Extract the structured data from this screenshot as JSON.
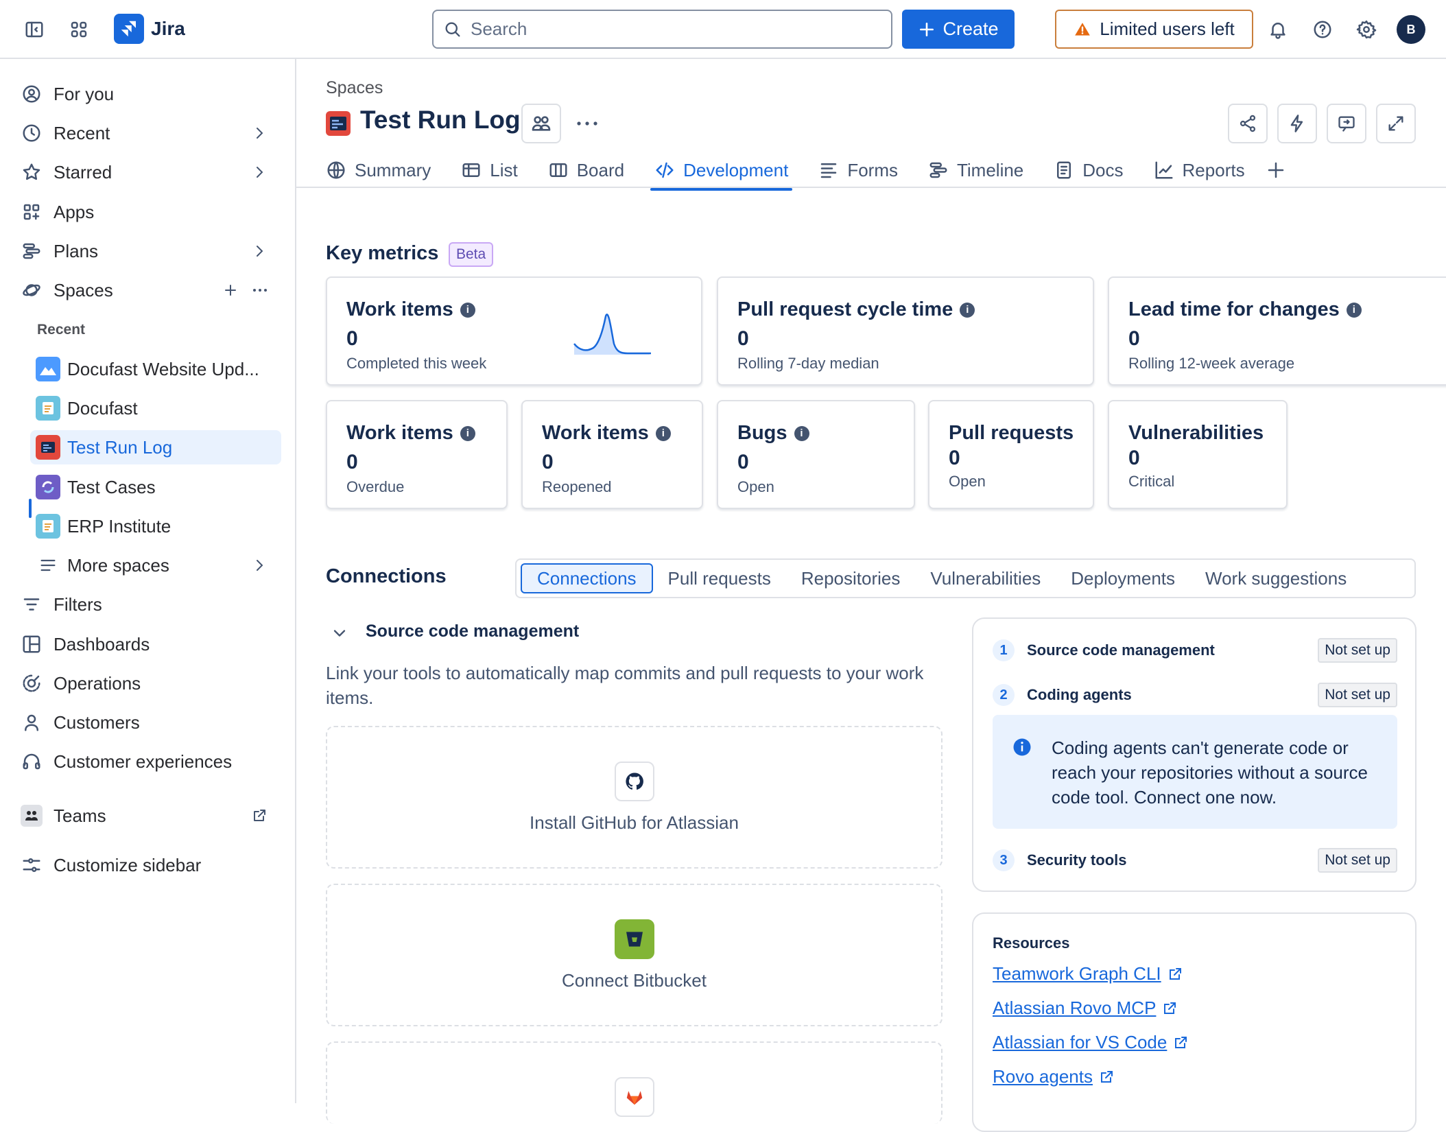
{
  "topbar": {
    "app_name": "Jira",
    "search_placeholder": "Search",
    "create_label": "Create",
    "limited_label": "Limited users left",
    "avatar_initial": "B"
  },
  "sidebar": {
    "items": [
      {
        "label": "For you",
        "icon": "user-circle-icon"
      },
      {
        "label": "Recent",
        "icon": "clock-icon"
      },
      {
        "label": "Starred",
        "icon": "star-icon"
      },
      {
        "label": "Apps",
        "icon": "apps-icon"
      },
      {
        "label": "Plans",
        "icon": "plans-icon"
      },
      {
        "label": "Spaces",
        "icon": "spaces-icon"
      }
    ],
    "recent_label": "Recent",
    "spaces": [
      {
        "label": "Docufast Website Upd...",
        "color": "#4c9aff"
      },
      {
        "label": "Docufast",
        "color": "#6cc3e0"
      },
      {
        "label": "Test Run Log",
        "color": "#e2483d"
      },
      {
        "label": "Test Cases",
        "color": "#6e5dc6"
      },
      {
        "label": "ERP Institute",
        "color": "#6cc3e0"
      }
    ],
    "more_spaces": "More spaces",
    "items2": [
      {
        "label": "Filters",
        "icon": "filter-icon"
      },
      {
        "label": "Dashboards",
        "icon": "dashboard-icon"
      },
      {
        "label": "Operations",
        "icon": "operations-icon"
      },
      {
        "label": "Customers",
        "icon": "person-icon"
      },
      {
        "label": "Customer experiences",
        "icon": "headphones-icon"
      }
    ],
    "teams": "Teams",
    "customize": "Customize sidebar"
  },
  "header": {
    "breadcrumb": "Spaces",
    "title": "Test Run Log",
    "tabs": [
      {
        "label": "Summary"
      },
      {
        "label": "List"
      },
      {
        "label": "Board"
      },
      {
        "label": "Development"
      },
      {
        "label": "Forms"
      },
      {
        "label": "Timeline"
      },
      {
        "label": "Docs"
      },
      {
        "label": "Reports"
      }
    ]
  },
  "metrics": {
    "title": "Key metrics",
    "beta": "Beta",
    "cards": [
      {
        "title": "Work items",
        "value": "0",
        "sub": "Completed this week"
      },
      {
        "title": "Pull request cycle time",
        "value": "0",
        "sub": "Rolling 7-day median"
      },
      {
        "title": "Lead time for changes",
        "value": "0",
        "sub": "Rolling 12-week average"
      },
      {
        "title": "Work items",
        "value": "0",
        "sub": "Overdue"
      },
      {
        "title": "Work items",
        "value": "0",
        "sub": "Reopened"
      },
      {
        "title": "Bugs",
        "value": "0",
        "sub": "Open"
      },
      {
        "title": "Pull requests",
        "value": "0",
        "sub": "Open"
      },
      {
        "title": "Vulnerabilities",
        "value": "0",
        "sub": "Critical"
      }
    ]
  },
  "connections": {
    "title": "Connections",
    "tabs": [
      "Connections",
      "Pull requests",
      "Repositories",
      "Vulnerabilities",
      "Deployments",
      "Work suggestions"
    ],
    "scm_title": "Source code management",
    "scm_desc": "Link your tools to automatically map commits and pull requests to your work items.",
    "install_github": "Install GitHub for Atlassian",
    "connect_bitbucket": "Connect Bitbucket",
    "steps": [
      {
        "num": "1",
        "name": "Source code management",
        "status": "Not set up"
      },
      {
        "num": "2",
        "name": "Coding agents",
        "status": "Not set up"
      },
      {
        "num": "3",
        "name": "Security tools",
        "status": "Not set up"
      }
    ],
    "info_text": "Coding agents can't generate code or reach your repositories without a source code tool. Connect one now.",
    "resources_title": "Resources",
    "resources": [
      "Teamwork Graph CLI",
      "Atlassian Rovo MCP",
      "Atlassian for VS Code",
      "Rovo agents"
    ]
  }
}
